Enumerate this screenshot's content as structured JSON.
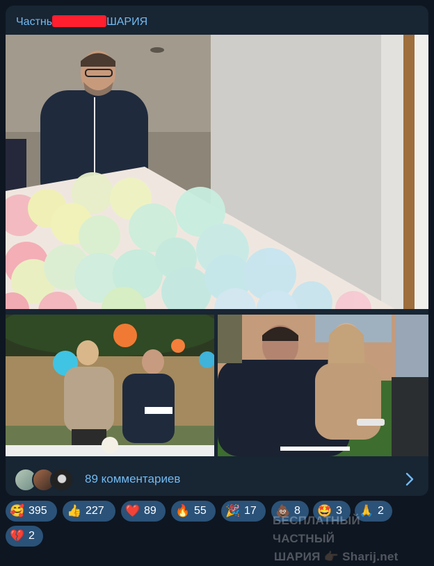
{
  "channel": {
    "title_left": "Частнь",
    "title_right": "ШАРИЯ"
  },
  "photos": {
    "main": "photo",
    "left": "photo",
    "right": "photo"
  },
  "comments": {
    "text": "89 комментариев"
  },
  "reactions": [
    {
      "emoji": "🥰",
      "count": "395"
    },
    {
      "emoji": "👍",
      "count": "227"
    },
    {
      "emoji": "❤️",
      "count": "89"
    },
    {
      "emoji": "🔥",
      "count": "55"
    },
    {
      "emoji": "🎉",
      "count": "17"
    },
    {
      "emoji": "💩",
      "count": "8"
    },
    {
      "emoji": "🤩",
      "count": "3"
    },
    {
      "emoji": "🙏",
      "count": "2"
    },
    {
      "emoji": "💔",
      "count": "2"
    }
  ],
  "watermark": {
    "line1": "БЕСПЛАТНЫЙ ЧАСТНЫЙ",
    "line2": "ШАРИЯ 👉🏽 Sharij.net"
  }
}
